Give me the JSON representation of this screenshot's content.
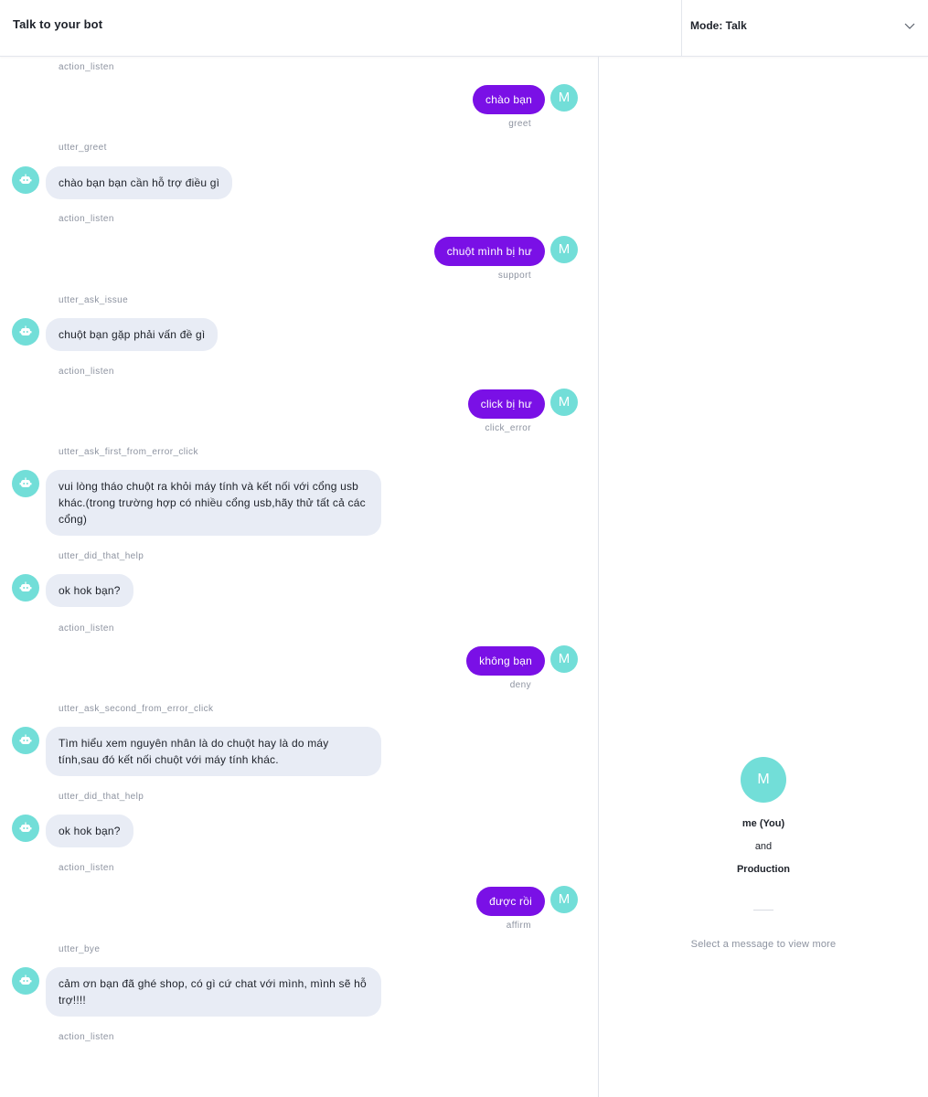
{
  "header": {
    "title": "Talk to your bot",
    "mode_label": "Mode: Talk"
  },
  "messages": [
    {
      "type": "action",
      "text": "action_listen"
    },
    {
      "type": "user",
      "text": "chào bạn",
      "intent": "greet",
      "avatar": "M"
    },
    {
      "type": "action",
      "text": "utter_greet"
    },
    {
      "type": "bot",
      "text": "chào bạn bạn cần hỗ trợ điều gì"
    },
    {
      "type": "action",
      "text": "action_listen"
    },
    {
      "type": "user",
      "text": "chuột mình bị hư",
      "intent": "support",
      "avatar": "M"
    },
    {
      "type": "action",
      "text": "utter_ask_issue"
    },
    {
      "type": "bot",
      "text": "chuột bạn gặp phải vấn đề gì"
    },
    {
      "type": "action",
      "text": "action_listen"
    },
    {
      "type": "user",
      "text": "click bị hư",
      "intent": "click_error",
      "avatar": "M"
    },
    {
      "type": "action",
      "text": "utter_ask_first_from_error_click"
    },
    {
      "type": "bot",
      "text": "vui lòng tháo chuột ra khỏi máy tính và kết nối với cổng usb khác.(trong trường hợp có nhiều cổng usb,hãy thử tất cả các cổng)"
    },
    {
      "type": "action",
      "text": "utter_did_that_help"
    },
    {
      "type": "bot",
      "text": "ok hok bạn?"
    },
    {
      "type": "action",
      "text": "action_listen"
    },
    {
      "type": "user",
      "text": "không bạn",
      "intent": "deny",
      "avatar": "M"
    },
    {
      "type": "action",
      "text": "utter_ask_second_from_error_click"
    },
    {
      "type": "bot",
      "text": "Tìm hiểu xem nguyên nhân là do chuột hay là do máy tính,sau đó kết nối chuột với máy tính khác."
    },
    {
      "type": "action",
      "text": "utter_did_that_help"
    },
    {
      "type": "bot",
      "text": "ok hok bạn?"
    },
    {
      "type": "action",
      "text": "action_listen"
    },
    {
      "type": "user",
      "text": "được rồi",
      "intent": "affirm",
      "avatar": "M"
    },
    {
      "type": "action",
      "text": "utter_bye"
    },
    {
      "type": "bot",
      "text": "cảm ơn bạn đã ghé shop, có gì cứ chat với mình, mình sẽ hỗ trợ!!!!"
    },
    {
      "type": "action",
      "text": "action_listen"
    }
  ],
  "sidebar": {
    "avatar": "M",
    "user_label": "me (You)",
    "and_label": "and",
    "env_label": "Production",
    "hint": "Select a message to view more"
  },
  "colors": {
    "user_bubble": "#7a10e6",
    "bot_bubble": "#e8ecf5",
    "avatar": "#72ded8"
  }
}
